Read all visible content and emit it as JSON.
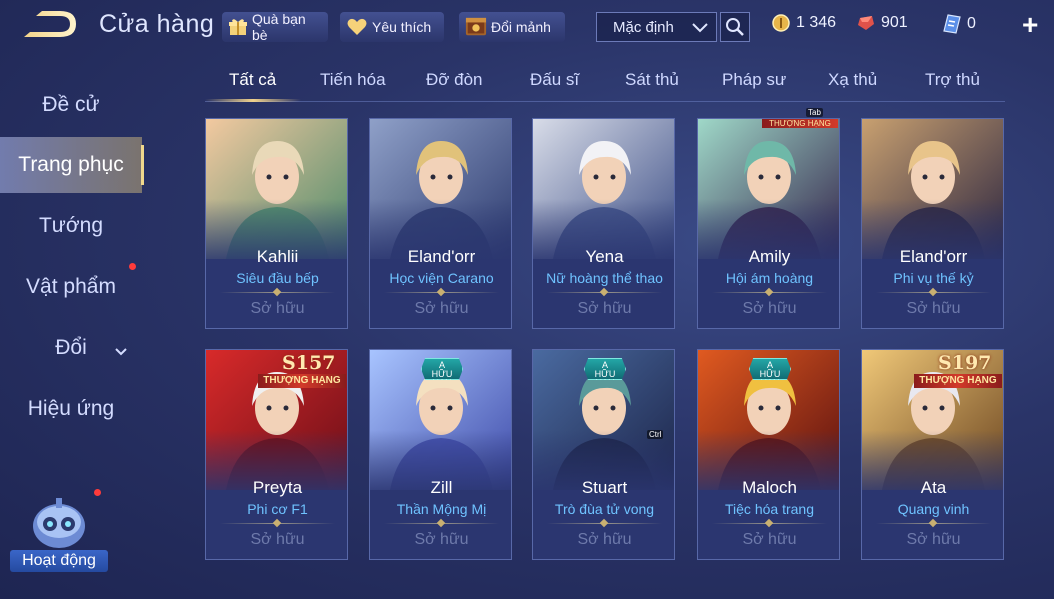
{
  "header": {
    "title": "Cửa hàng",
    "chips": {
      "gift": "Quà bạn bè",
      "favorite": "Yêu thích",
      "shard": "Đổi mảnh"
    },
    "sort": {
      "selected": "Mặc định"
    },
    "currencies": {
      "gold": "1 346",
      "ruby": "901",
      "voucher": "0"
    },
    "plus": "+"
  },
  "sidebar": {
    "items": [
      {
        "label": "Đề cử"
      },
      {
        "label": "Trang phục"
      },
      {
        "label": "Tướng"
      },
      {
        "label": "Vật phẩm"
      },
      {
        "label": "Đổi"
      },
      {
        "label": "Hiệu ứng"
      }
    ],
    "activity_label": "Hoạt động"
  },
  "tabs": [
    {
      "label": "Tất cả"
    },
    {
      "label": "Tiến hóa"
    },
    {
      "label": "Đỡ đòn"
    },
    {
      "label": "Đấu sĩ"
    },
    {
      "label": "Sát thủ"
    },
    {
      "label": "Pháp sư"
    },
    {
      "label": "Xạ thủ"
    },
    {
      "label": "Trợ thủ"
    }
  ],
  "tooltips": {
    "tab": "Tab",
    "ctrl": "Ctrl"
  },
  "badges": {
    "limited_letter": "A",
    "limited_text": "HỮU HẠN",
    "rank_text": "THƯỢNG HẠNG",
    "season_157": "S157",
    "season_197": "S197"
  },
  "items": [
    {
      "hero": "Kahlii",
      "skin": "Siêu đầu bếp",
      "status": "Sở hữu",
      "palette": [
        "#f3c9a0",
        "#4a8a6a",
        "#e9d9b8"
      ]
    },
    {
      "hero": "Eland'orr",
      "skin": "Học viện Carano",
      "status": "Sở hữu",
      "palette": [
        "#8fa0c8",
        "#2c3a6e",
        "#e1c27a"
      ]
    },
    {
      "hero": "Yena",
      "skin": "Nữ hoàng thể thao",
      "status": "Sở hữu",
      "palette": [
        "#d8dce8",
        "#3c4e86",
        "#f2f2f6"
      ]
    },
    {
      "hero": "Amily",
      "skin": "Hội ám hoàng",
      "status": "Sở hữu",
      "palette": [
        "#9fd8c8",
        "#33224a",
        "#6fb8a8"
      ]
    },
    {
      "hero": "Eland'orr",
      "skin": "Phi vụ thế kỷ",
      "status": "Sở hữu",
      "palette": [
        "#c8a070",
        "#2a2440",
        "#e8c48a"
      ]
    },
    {
      "hero": "Preyta",
      "skin": "Phi cơ F1",
      "status": "Sở hữu",
      "palette": [
        "#d82a2a",
        "#6a0e18",
        "#f0f0f0"
      ]
    },
    {
      "hero": "Zill",
      "skin": "Thần Mộng Mị",
      "status": "Sở hữu",
      "palette": [
        "#a8c4ff",
        "#3e4aa8",
        "#f4e0c0"
      ]
    },
    {
      "hero": "Stuart",
      "skin": "Trò đùa tử vong",
      "status": "Sở hữu",
      "palette": [
        "#4a6aa0",
        "#1c2448",
        "#5a9a9a"
      ]
    },
    {
      "hero": "Maloch",
      "skin": "Tiệc hóa trang",
      "status": "Sở hữu",
      "palette": [
        "#e05a20",
        "#5a1010",
        "#f0c040"
      ]
    },
    {
      "hero": "Ata",
      "skin": "Quang vinh",
      "status": "Sở hữu",
      "palette": [
        "#f0c878",
        "#6a4420",
        "#e8e8f0"
      ]
    }
  ]
}
